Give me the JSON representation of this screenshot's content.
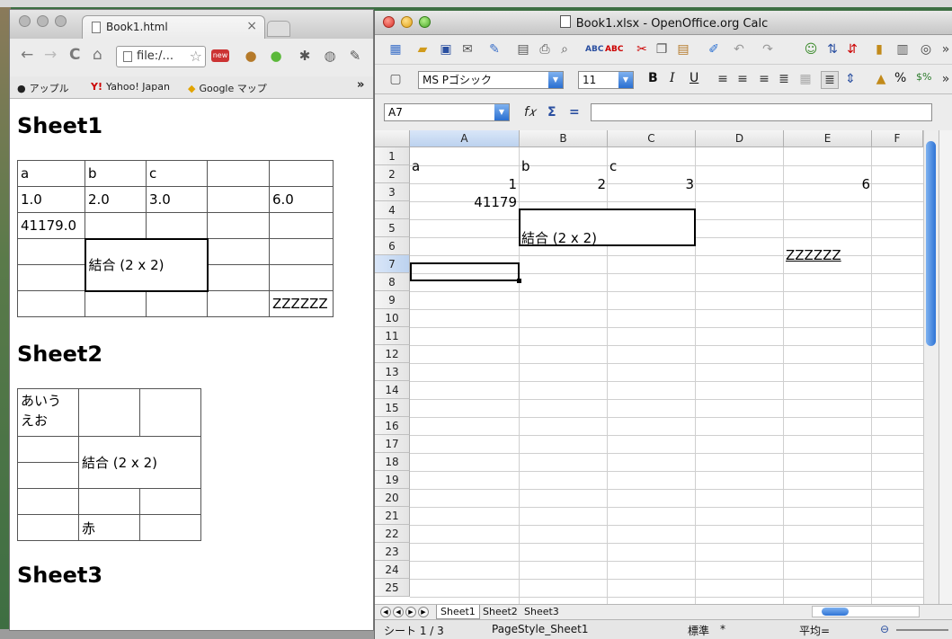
{
  "browser": {
    "tab_title": "Book1.html",
    "tab_close": "×",
    "url": "file:/...",
    "nav": {
      "back": "←",
      "forward": "→",
      "reload": "C",
      "home": "⌂"
    },
    "bookmarks": [
      {
        "icon": "",
        "label": "アップル"
      },
      {
        "icon": "Y!",
        "label": "Yahoo! Japan"
      },
      {
        "icon": "",
        "label": "Google マップ"
      }
    ],
    "bookmarks_more": "»",
    "sheet1": {
      "title": "Sheet1",
      "rows": [
        [
          "a",
          "b",
          "c",
          "",
          ""
        ],
        [
          "1.0",
          "2.0",
          "3.0",
          "",
          "6.0"
        ],
        [
          "41179.0",
          "",
          "",
          "",
          ""
        ]
      ],
      "merged": "結合 (2 x 2)",
      "last_cell": "ZZZZZZ"
    },
    "sheet2": {
      "title": "Sheet2",
      "top_left": "あいう\nえお",
      "merged": "結合 (2 x 2)",
      "red_cell": "赤"
    },
    "sheet3": {
      "title": "Sheet3"
    }
  },
  "calc": {
    "window_title": "Book1.xlsx - OpenOffice.org Calc",
    "font_name": "MS Pゴシック",
    "font_size": "11",
    "fmt": {
      "bold": "B",
      "italic": "I",
      "underline": "U",
      "percent": "%",
      "currency": "$%"
    },
    "name_box": "A7",
    "formula_icons": {
      "fx": "f𝑥",
      "sum": "Σ",
      "equals": "="
    },
    "formula_value": "",
    "columns": [
      "A",
      "B",
      "C",
      "D",
      "E",
      "F"
    ],
    "selected_column": "A",
    "rows": [
      "1",
      "2",
      "3",
      "4",
      "5",
      "6",
      "7",
      "8",
      "9",
      "10",
      "11",
      "12",
      "13",
      "14",
      "15",
      "16",
      "17",
      "18",
      "19",
      "20",
      "21",
      "22",
      "23",
      "24",
      "25"
    ],
    "selected_row": "7",
    "cells": {
      "A1": "a",
      "B1": "b",
      "C1": "c",
      "A2": "1",
      "B2": "2",
      "C2": "3",
      "E2": "6",
      "A3": "41179",
      "B4": "結合 (2 x 2)",
      "E6": "ZZZZZZ"
    },
    "sheet_tabs": [
      "Sheet1",
      "Sheet2",
      "Sheet3"
    ],
    "active_sheet": "Sheet1",
    "status": {
      "sheet": "シート 1 / 3",
      "page_style": "PageStyle_Sheet1",
      "mode": "標準",
      "modified": "*",
      "sum": "平均="
    }
  }
}
